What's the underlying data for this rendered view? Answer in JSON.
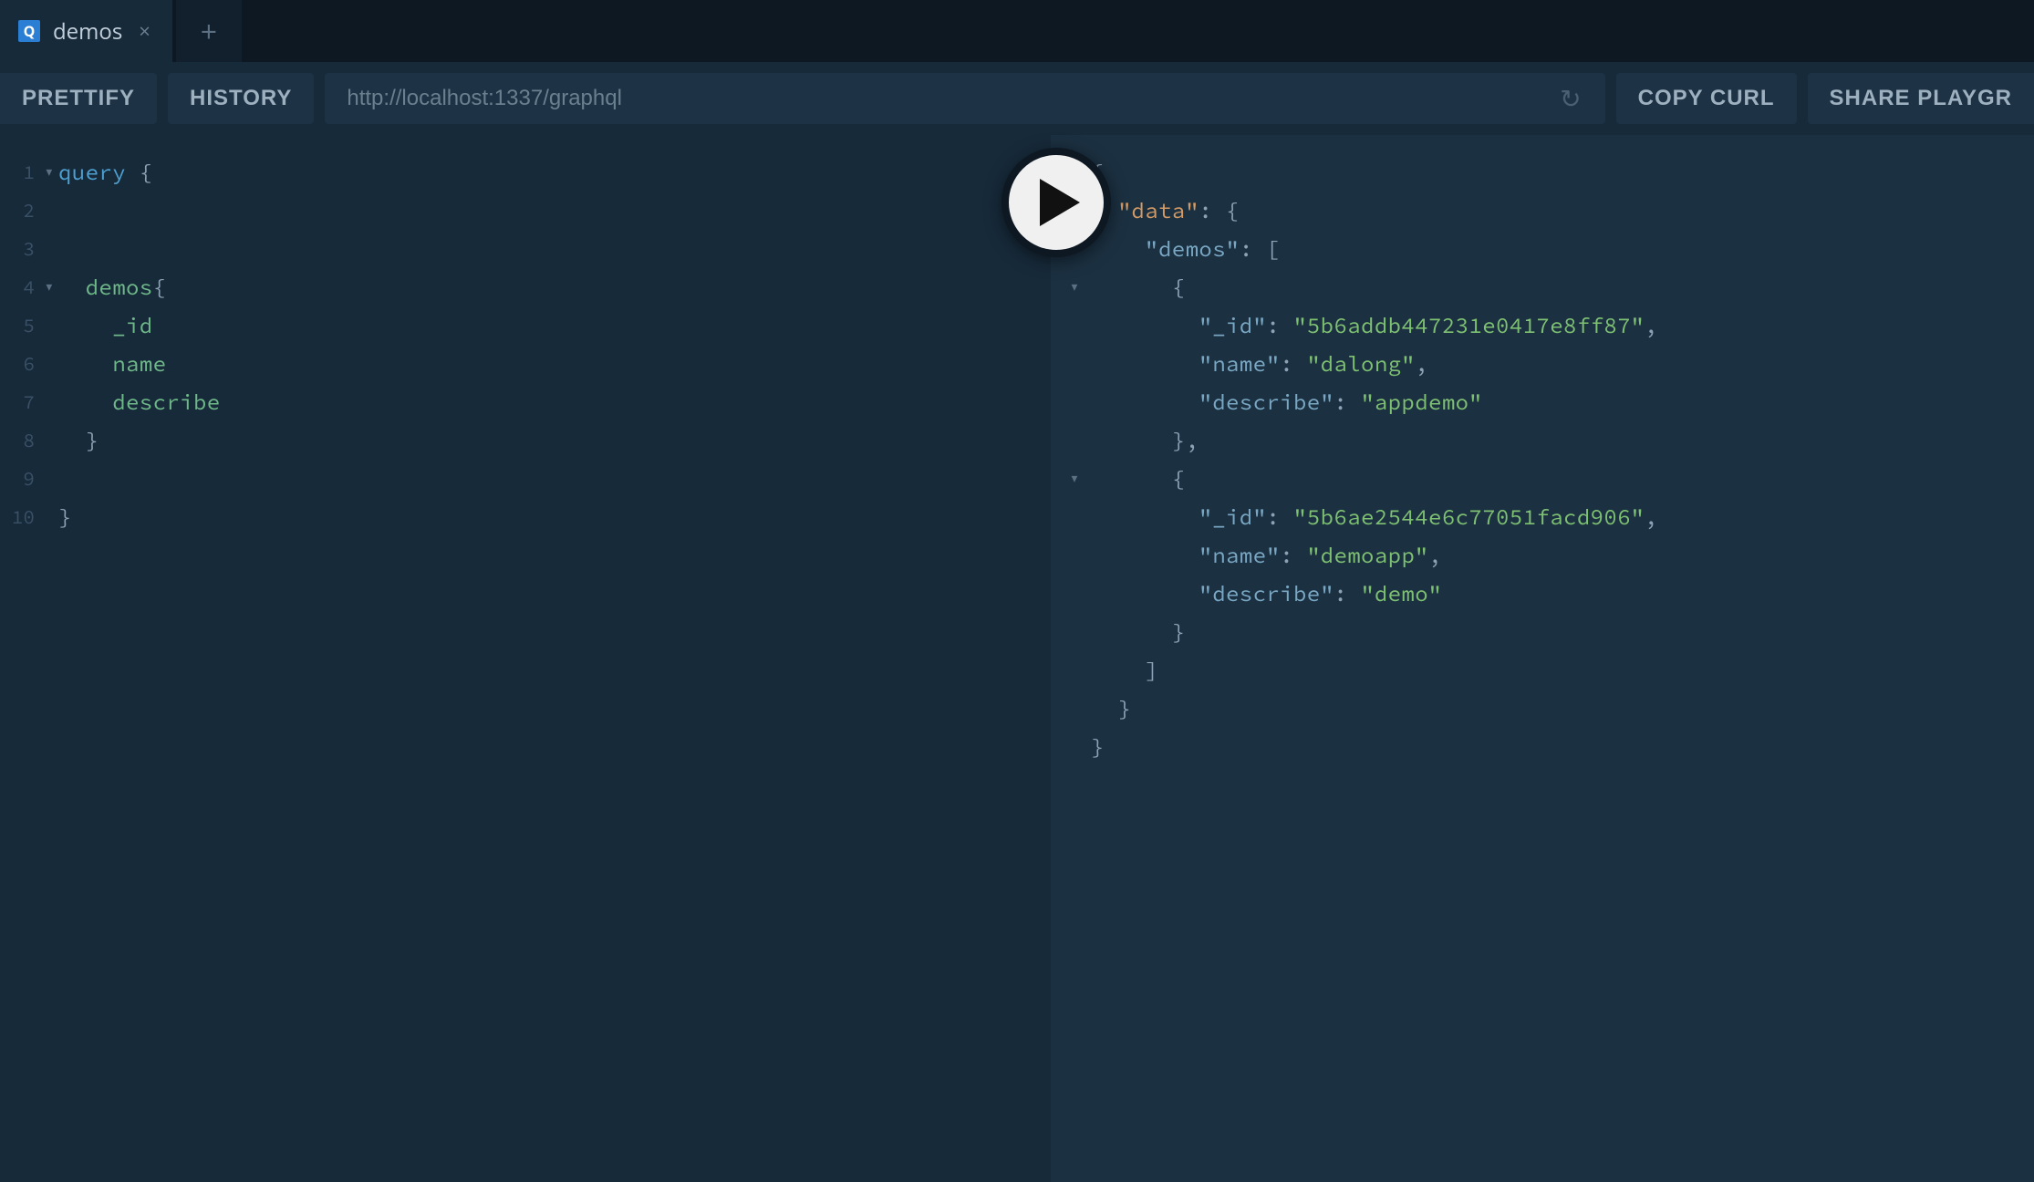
{
  "tab": {
    "icon_letter": "Q",
    "title": "demos",
    "close_glyph": "×",
    "add_glyph": "+"
  },
  "toolbar": {
    "prettify": "PRETTIFY",
    "history": "HISTORY",
    "url": "http://localhost:1337/graphql",
    "reload_glyph": "↻",
    "copy_curl": "COPY CURL",
    "share": "SHARE PLAYGR"
  },
  "editor": {
    "lines": {
      "l1_keyword": "query",
      "l1_open": " {",
      "l4_demos": "  demos",
      "l4_open": "{",
      "l5": "    _id",
      "l6": "    name",
      "l7": "    describe",
      "l8": "  }",
      "l10": "}"
    },
    "nums": [
      "1",
      "2",
      "3",
      "4",
      "5",
      "6",
      "7",
      "8",
      "9",
      "10"
    ]
  },
  "response": {
    "tokens": {
      "open": "{",
      "data_key": "\"data\"",
      "colon": ":",
      "space": " ",
      "open2": "{",
      "demos_key": "\"demos\"",
      "open_arr": "[",
      "open3": "{",
      "id_key": "\"_id\"",
      "id1": "\"5b6addb447231e0417e8ff87\"",
      "comma": ",",
      "name_key": "\"name\"",
      "name1": "\"dalong\"",
      "desc_key": "\"describe\"",
      "desc1": "\"appdemo\"",
      "close3": "}",
      "open4": "{",
      "id2": "\"5b6ae2544e6c77051facd906\"",
      "name2": "\"demoapp\"",
      "desc2": "\"demo\"",
      "close4": "}",
      "close_arr": "]",
      "close2": "}",
      "close": "}"
    }
  }
}
